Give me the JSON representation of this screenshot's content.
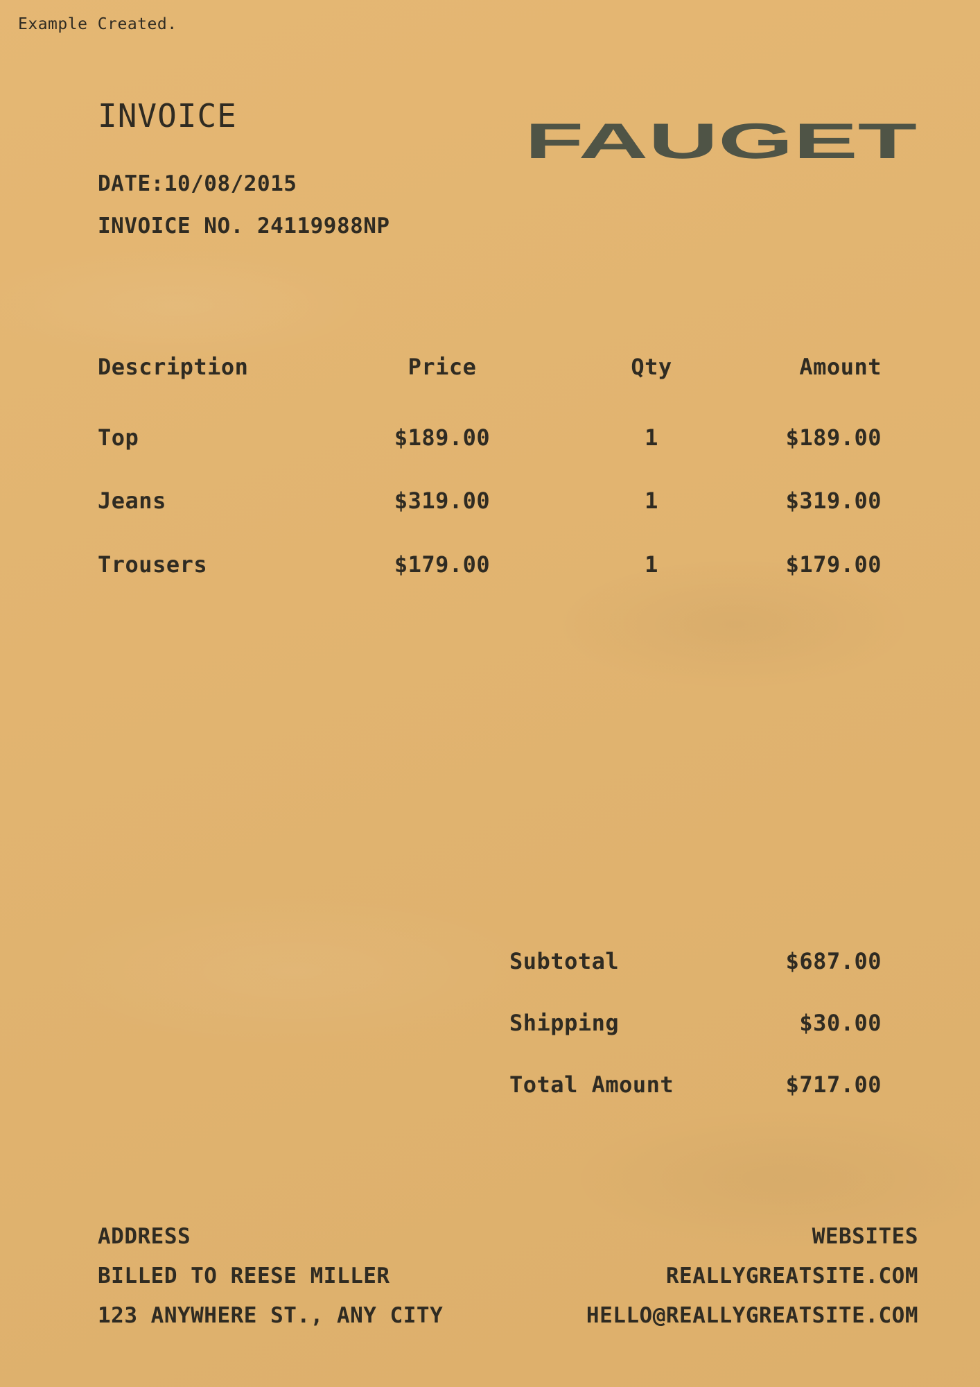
{
  "watermark": "Example Created.",
  "header": {
    "title": "INVOICE",
    "date": "DATE:10/08/2015",
    "invoice_no": "INVOICE NO. 24119988NP",
    "brand": "FAUGET",
    "brand_color": "#4f5446"
  },
  "items": {
    "columns": [
      "Description",
      "Price",
      "Qty",
      "Amount"
    ],
    "rows": [
      {
        "description": "Top",
        "price": "$189.00",
        "qty": "1",
        "amount": "$189.00"
      },
      {
        "description": "Jeans",
        "price": "$319.00",
        "qty": "1",
        "amount": "$319.00"
      },
      {
        "description": "Trousers",
        "price": "$179.00",
        "qty": "1",
        "amount": "$179.00"
      }
    ]
  },
  "totals": [
    {
      "label": "Subtotal",
      "value": "$687.00"
    },
    {
      "label": "Shipping",
      "value": "$30.00"
    },
    {
      "label": "Total Amount",
      "value": "$717.00"
    }
  ],
  "footer": {
    "address_heading": "ADDRESS",
    "billed_to": "BILLED TO REESE MILLER",
    "street": "123 ANYWHERE ST., ANY CITY",
    "websites_heading": "WEBSITES",
    "website": "REALLYGREATSITE.COM",
    "email": "HELLO@REALLYGREATSITE.COM"
  },
  "colors": {
    "paper": "#e4b56f",
    "ink": "#2f2b22"
  }
}
